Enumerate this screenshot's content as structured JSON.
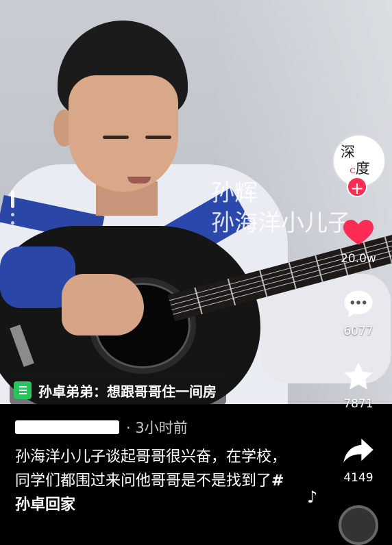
{
  "video": {
    "subtitle_line1": "孙辉",
    "subtitle_line2": "孙海洋小儿子"
  },
  "channel": {
    "logo_text_1": "深",
    "logo_text_2": "度",
    "logo_mark": "C",
    "follow_label": "+"
  },
  "actions": {
    "like_count": "20.0w",
    "comment_count": "6077",
    "favorite_count": "7871",
    "share_count": "4149",
    "like_color": "#fe2c55"
  },
  "chip": {
    "text": "孙卓弟弟：想跟哥哥住一间房",
    "icon": "list-icon"
  },
  "post": {
    "time": "· 3小时前",
    "caption_text": "孙海洋小儿子谈起哥哥很兴奋，在学校，同学们都围过来问他哥哥是不是找到了",
    "hashtag": "#孙卓回家",
    "music_icon": "music-note-icon"
  }
}
